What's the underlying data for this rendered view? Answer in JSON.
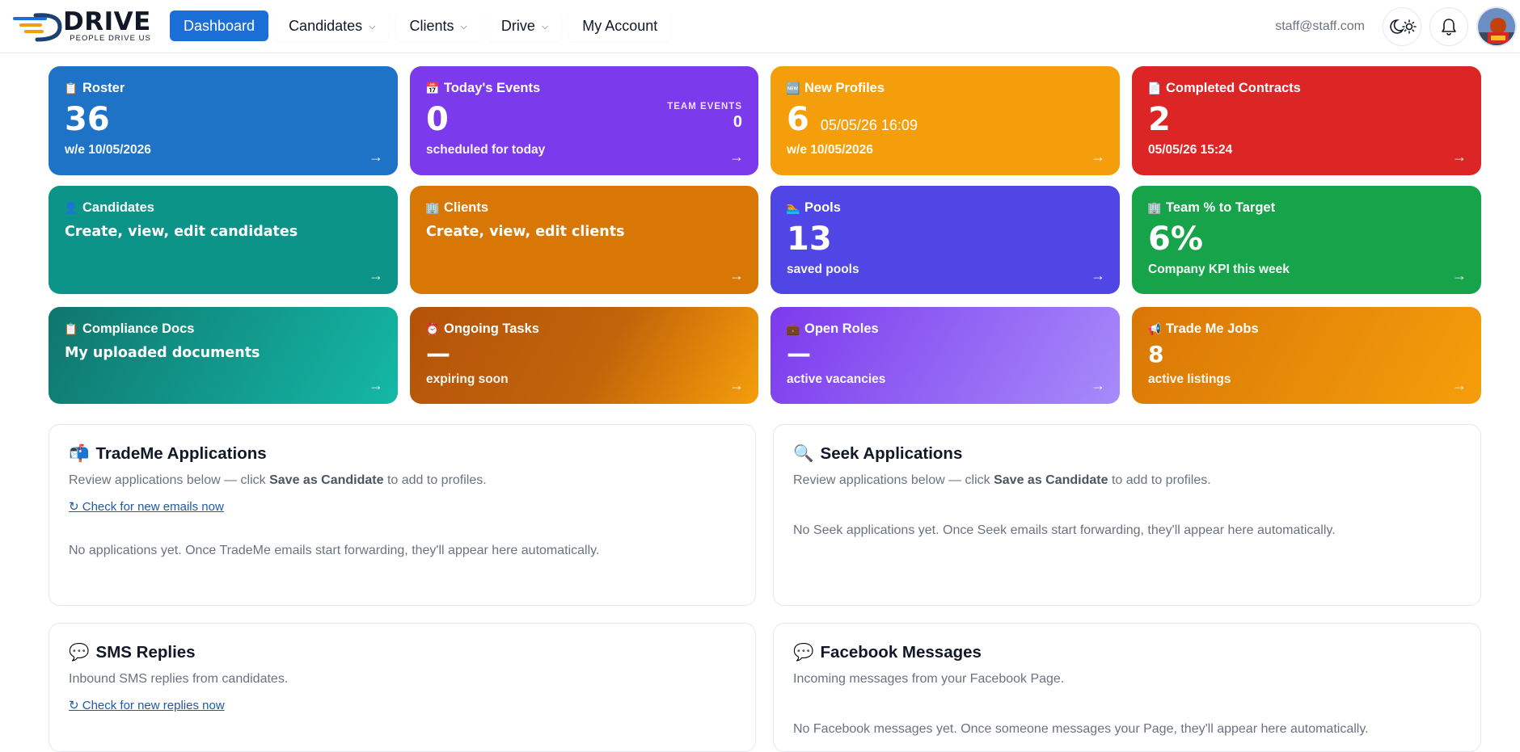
{
  "brand": {
    "name": "DRIVE",
    "tagline": "PEOPLE DRIVE US"
  },
  "nav": {
    "items": [
      {
        "label": "Dashboard",
        "active": true
      },
      {
        "label": "Candidates",
        "dropdown": true
      },
      {
        "label": "Clients",
        "dropdown": true
      },
      {
        "label": "Drive",
        "dropdown": true
      },
      {
        "label": "My Account"
      }
    ]
  },
  "user": {
    "email": "staff@staff.com"
  },
  "colors": {
    "nav_active": "#1d6fd8",
    "roster": "#1f73c7",
    "events": "#7c3aed",
    "new_profiles": "#f59e0b",
    "completed_contracts": "#dc2626",
    "candidates": "#0d9488",
    "clients": "#d97706",
    "pools": "#4f46e5",
    "team_target": "#16a34a",
    "compliance": "#0f766e",
    "ongoing": "#b45309",
    "open_roles": "#8b5cf6",
    "trademe": "#d97706"
  },
  "tiles": {
    "roster": {
      "icon": "clipboard-icon",
      "title": "Roster",
      "value": "36",
      "sub": "w/e 10/05/2026"
    },
    "events": {
      "icon": "calendar-icon",
      "title": "Today's Events",
      "value": "0",
      "sub": "scheduled for today",
      "team_label": "TEAM EVENTS",
      "team_value": "0"
    },
    "new_profiles": {
      "icon": "new-badge-icon",
      "title": "New Profiles",
      "value": "6",
      "time": "05/05/26 16:09",
      "sub": "w/e 10/05/2026"
    },
    "completed_contracts": {
      "icon": "document-icon",
      "title": "Completed Contracts",
      "value": "2",
      "sub": "05/05/26 15:24"
    },
    "candidates": {
      "icon": "person-icon",
      "title": "Candidates",
      "text": "Create, view, edit candidates"
    },
    "clients": {
      "icon": "office-building-icon",
      "title": "Clients",
      "text": "Create, view, edit clients"
    },
    "pools": {
      "icon": "swimmer-icon",
      "title": "Pools",
      "value": "13",
      "sub": "saved pools"
    },
    "team_target": {
      "icon": "office-building-icon",
      "title": "Team % to Target",
      "value": "6%",
      "sub": "Company KPI this week"
    },
    "compliance": {
      "icon": "clipboard-icon",
      "title": "Compliance Docs",
      "text": "My uploaded documents"
    },
    "ongoing": {
      "icon": "alarm-clock-icon",
      "title": "Ongoing Tasks",
      "value": "—",
      "sub": "expiring soon"
    },
    "open_roles": {
      "icon": "briefcase-icon",
      "title": "Open Roles",
      "value": "—",
      "sub": "active vacancies"
    },
    "trademe_jobs": {
      "icon": "megaphone-icon",
      "title": "Trade Me Jobs",
      "value": "8",
      "sub": "active listings"
    },
    "arrow": "→"
  },
  "panels": {
    "trademe": {
      "icon": "mailbox-icon",
      "title": "TradeMe Applications",
      "desc_pre": "Review applications below — click ",
      "desc_bold": "Save as Candidate",
      "desc_post": " to add to profiles.",
      "link": "↻ Check for new emails now",
      "empty": "No applications yet. Once TradeMe emails start forwarding, they'll appear here automatically."
    },
    "seek": {
      "icon": "magnifier-icon",
      "title": "Seek Applications",
      "desc_pre": "Review applications below — click ",
      "desc_bold": "Save as Candidate",
      "desc_post": " to add to profiles.",
      "empty": "No Seek applications yet. Once Seek emails start forwarding, they'll appear here automatically."
    },
    "sms": {
      "icon": "speech-bubble-icon",
      "title": "SMS Replies",
      "desc": "Inbound SMS replies from candidates.",
      "link": "↻ Check for new replies now"
    },
    "facebook": {
      "icon": "speech-bubble-icon",
      "title": "Facebook Messages",
      "desc": "Incoming messages from your Facebook Page.",
      "empty": "No Facebook messages yet. Once someone messages your Page, they'll appear here automatically."
    }
  }
}
